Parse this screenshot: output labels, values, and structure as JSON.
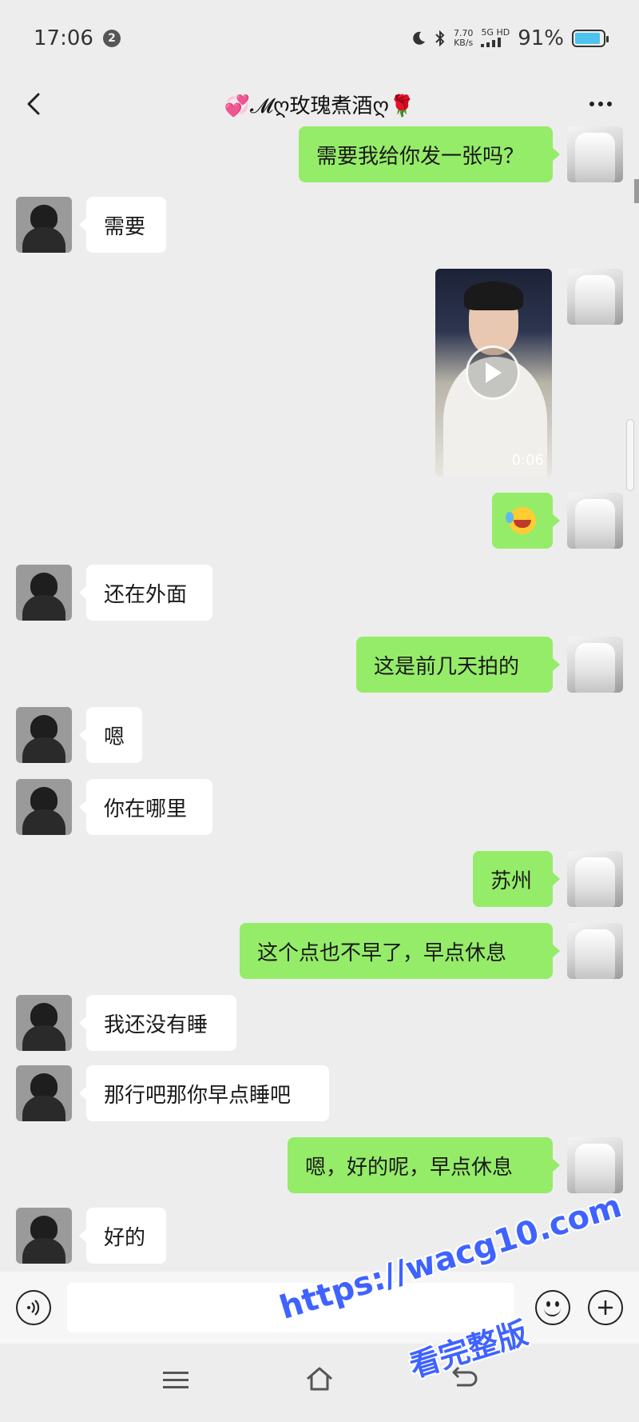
{
  "status_bar": {
    "time": "17:06",
    "notification_badge": "2",
    "net_speed_value": "7.70",
    "net_speed_unit": "KB/s",
    "network": "5G HD",
    "battery": "91%",
    "battery_level": 0.91
  },
  "header": {
    "title": "💞𝓜ღ玫瑰煮酒ღ🌹"
  },
  "messages": [
    {
      "sender": "self",
      "type": "text",
      "text": "需要我给你发一张吗？"
    },
    {
      "sender": "other",
      "type": "text",
      "text": "需要"
    },
    {
      "sender": "self",
      "type": "video",
      "duration": "0:06"
    },
    {
      "sender": "self",
      "type": "emoji",
      "icon": "laughing-crying-emoji"
    },
    {
      "sender": "other",
      "type": "text",
      "text": "还在外面"
    },
    {
      "sender": "self",
      "type": "text",
      "text": "这是前几天拍的"
    },
    {
      "sender": "other",
      "type": "text",
      "text": "嗯"
    },
    {
      "sender": "other",
      "type": "text",
      "text": "你在哪里"
    },
    {
      "sender": "self",
      "type": "text",
      "text": "苏州"
    },
    {
      "sender": "self",
      "type": "text",
      "text": "这个点也不早了，早点休息"
    },
    {
      "sender": "other",
      "type": "text",
      "text": "我还没有睡"
    },
    {
      "sender": "other",
      "type": "text",
      "text": "那行吧那你早点睡吧"
    },
    {
      "sender": "self",
      "type": "text",
      "text": "嗯，好的呢，早点休息"
    },
    {
      "sender": "other",
      "type": "text",
      "text": "好的"
    }
  ],
  "input_bar": {
    "placeholder": ""
  },
  "watermark": {
    "url": "https://wacg10.com",
    "text": "看完整版"
  },
  "colors": {
    "self_bubble": "#95ec69",
    "other_bubble": "#ffffff",
    "background": "#ededed",
    "watermark": "#3f63ff"
  }
}
